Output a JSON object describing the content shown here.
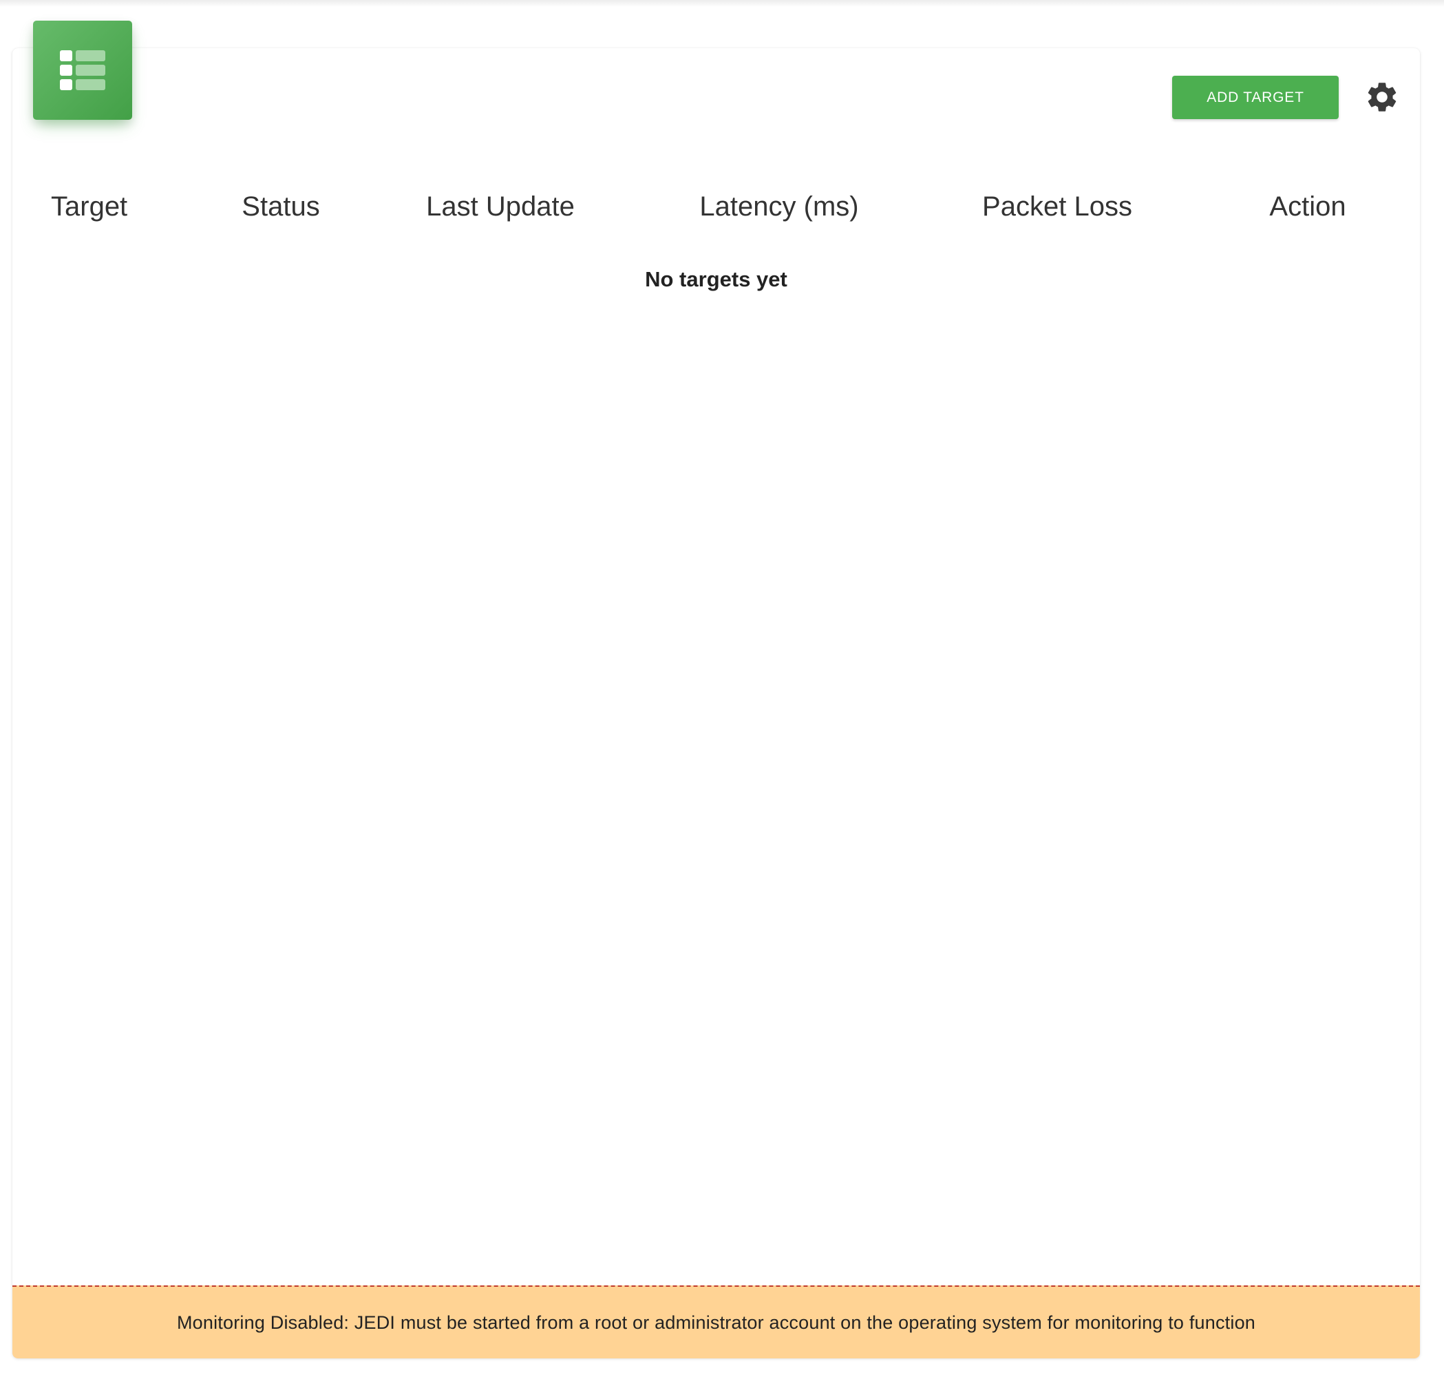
{
  "header": {
    "icon": "table-list-icon",
    "add_target_label": "ADD TARGET",
    "settings_icon": "gear-icon"
  },
  "table": {
    "columns": [
      "Target",
      "Status",
      "Last Update",
      "Latency (ms)",
      "Packet Loss",
      "Action"
    ],
    "rows": [],
    "empty_message": "No targets yet"
  },
  "banner": {
    "message": "Monitoring Disabled: JEDI must be started from a root or administrator account on the operating system for monitoring to function"
  },
  "colors": {
    "accent": "#4caf50",
    "banner_background": "#ffd394",
    "banner_border": "#c0392b"
  }
}
